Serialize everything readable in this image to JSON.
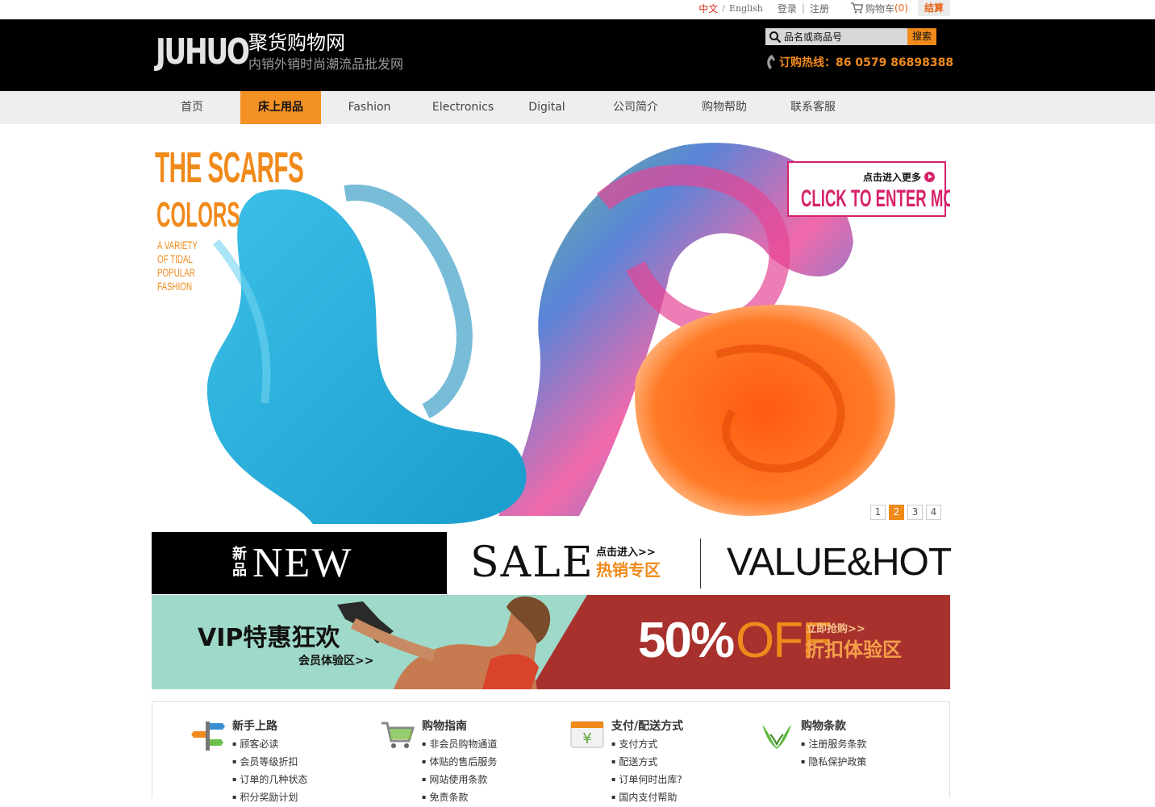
{
  "topbar": {
    "lang_cn": "中文",
    "lang_sep": "/",
    "lang_en": "English",
    "login": "登录",
    "register": "注册",
    "cart_label": "购物车",
    "cart_count": "(0)",
    "checkout": "结算"
  },
  "header": {
    "logo": "JUHUO",
    "site_name": "聚货购物网",
    "slogan": "内销外销时尚潮流品批发网",
    "search_placeholder": "品名或商品号",
    "search_button": "搜索",
    "hotline": "订购热线：86 0579 86898388"
  },
  "nav": {
    "items": [
      {
        "label": "首页"
      },
      {
        "label": "床上用品"
      },
      {
        "label": "Fashion"
      },
      {
        "label": "Electronics"
      },
      {
        "label": "Digital"
      },
      {
        "label": "公司简介"
      },
      {
        "label": "购物帮助"
      },
      {
        "label": "联系客服"
      }
    ],
    "active_index": 1
  },
  "banner": {
    "title1": "THE SCARFS",
    "title2": "COLORS",
    "subtitle": "A VARIETY OF TIDAL POPULAR FASHION",
    "more_cn": "点击进入更多",
    "more_en": "CLICK TO ENTER MORE",
    "pages": [
      "1",
      "2",
      "3",
      "4"
    ],
    "active_page": "2"
  },
  "promo": {
    "new_cn": "新品",
    "new_en": "NEW",
    "sale_en": "SALE",
    "sale_cn1": "点击进入>>",
    "sale_cn2": "热销专区",
    "value_hot": "VALUE&HOT"
  },
  "vip": {
    "title": "VIP特惠狂欢",
    "subtitle": "会员体验区>>",
    "percent": "50%",
    "off": "OFF",
    "cta1": "立即抢购>>",
    "cta2": "折扣体验区"
  },
  "help": {
    "columns": [
      {
        "title": "新手上路",
        "icon": "signpost-icon",
        "items": [
          "顾客必读",
          "会员等级折扣",
          "订单的几种状态",
          "积分奖励计划"
        ]
      },
      {
        "title": "购物指南",
        "icon": "cart-icon",
        "items": [
          "非会员购物通道",
          "体贴的售后服务",
          "网站使用条款",
          "免责条款"
        ]
      },
      {
        "title": "支付/配送方式",
        "icon": "payment-icon",
        "items": [
          "支付方式",
          "配送方式",
          "订单何时出库?",
          "国内支付帮助"
        ]
      },
      {
        "title": "购物条款",
        "icon": "hands-icon",
        "items": [
          "注册服务条款",
          "隐私保护政策"
        ]
      }
    ]
  },
  "colors": {
    "accent": "#f08a1a",
    "header_bg": "#000000",
    "nav_bg": "#eeeeee",
    "magenta": "#d6226b",
    "vip_left": "#9fd9c9",
    "vip_right": "#a8312d"
  }
}
